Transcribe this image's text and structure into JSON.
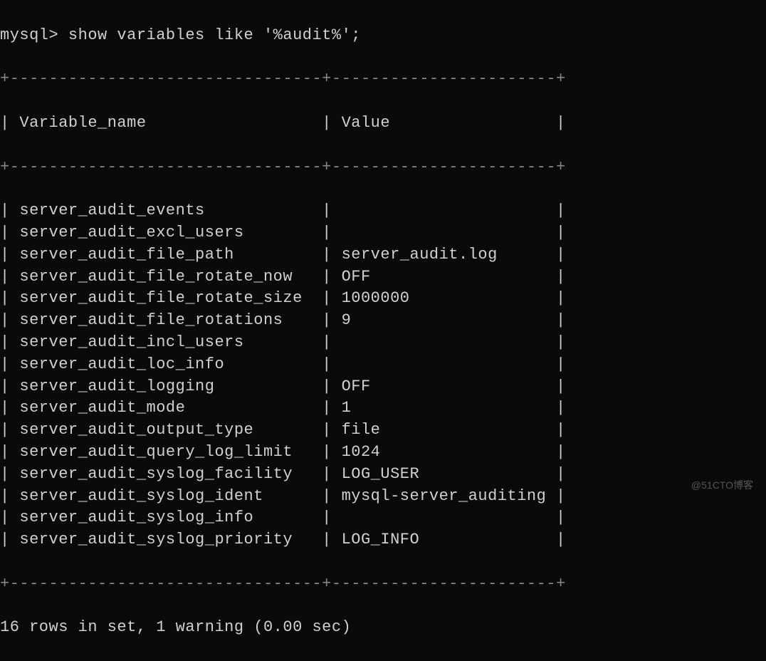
{
  "prompt": "mysql> show variables like '%audit%';",
  "table": {
    "header": {
      "col1": "Variable_name",
      "col2": "Value"
    },
    "border_top": "+--------------------------------+-----------------------+",
    "border_mid": "+--------------------------------+-----------------------+",
    "border_bot": "+--------------------------------+-----------------------+",
    "rows": [
      {
        "name": "server_audit_events",
        "value": ""
      },
      {
        "name": "server_audit_excl_users",
        "value": ""
      },
      {
        "name": "server_audit_file_path",
        "value": "server_audit.log"
      },
      {
        "name": "server_audit_file_rotate_now",
        "value": "OFF"
      },
      {
        "name": "server_audit_file_rotate_size",
        "value": "1000000"
      },
      {
        "name": "server_audit_file_rotations",
        "value": "9"
      },
      {
        "name": "server_audit_incl_users",
        "value": ""
      },
      {
        "name": "server_audit_loc_info",
        "value": ""
      },
      {
        "name": "server_audit_logging",
        "value": "OFF"
      },
      {
        "name": "server_audit_mode",
        "value": "1"
      },
      {
        "name": "server_audit_output_type",
        "value": "file"
      },
      {
        "name": "server_audit_query_log_limit",
        "value": "1024"
      },
      {
        "name": "server_audit_syslog_facility",
        "value": "LOG_USER"
      },
      {
        "name": "server_audit_syslog_ident",
        "value": "mysql-server_auditing"
      },
      {
        "name": "server_audit_syslog_info",
        "value": ""
      },
      {
        "name": "server_audit_syslog_priority",
        "value": "LOG_INFO"
      }
    ]
  },
  "footer": "16 rows in set, 1 warning (0.00 sec)",
  "watermark": "@51CTO博客",
  "layout": {
    "col1_width": 30,
    "col2_width": 21
  }
}
